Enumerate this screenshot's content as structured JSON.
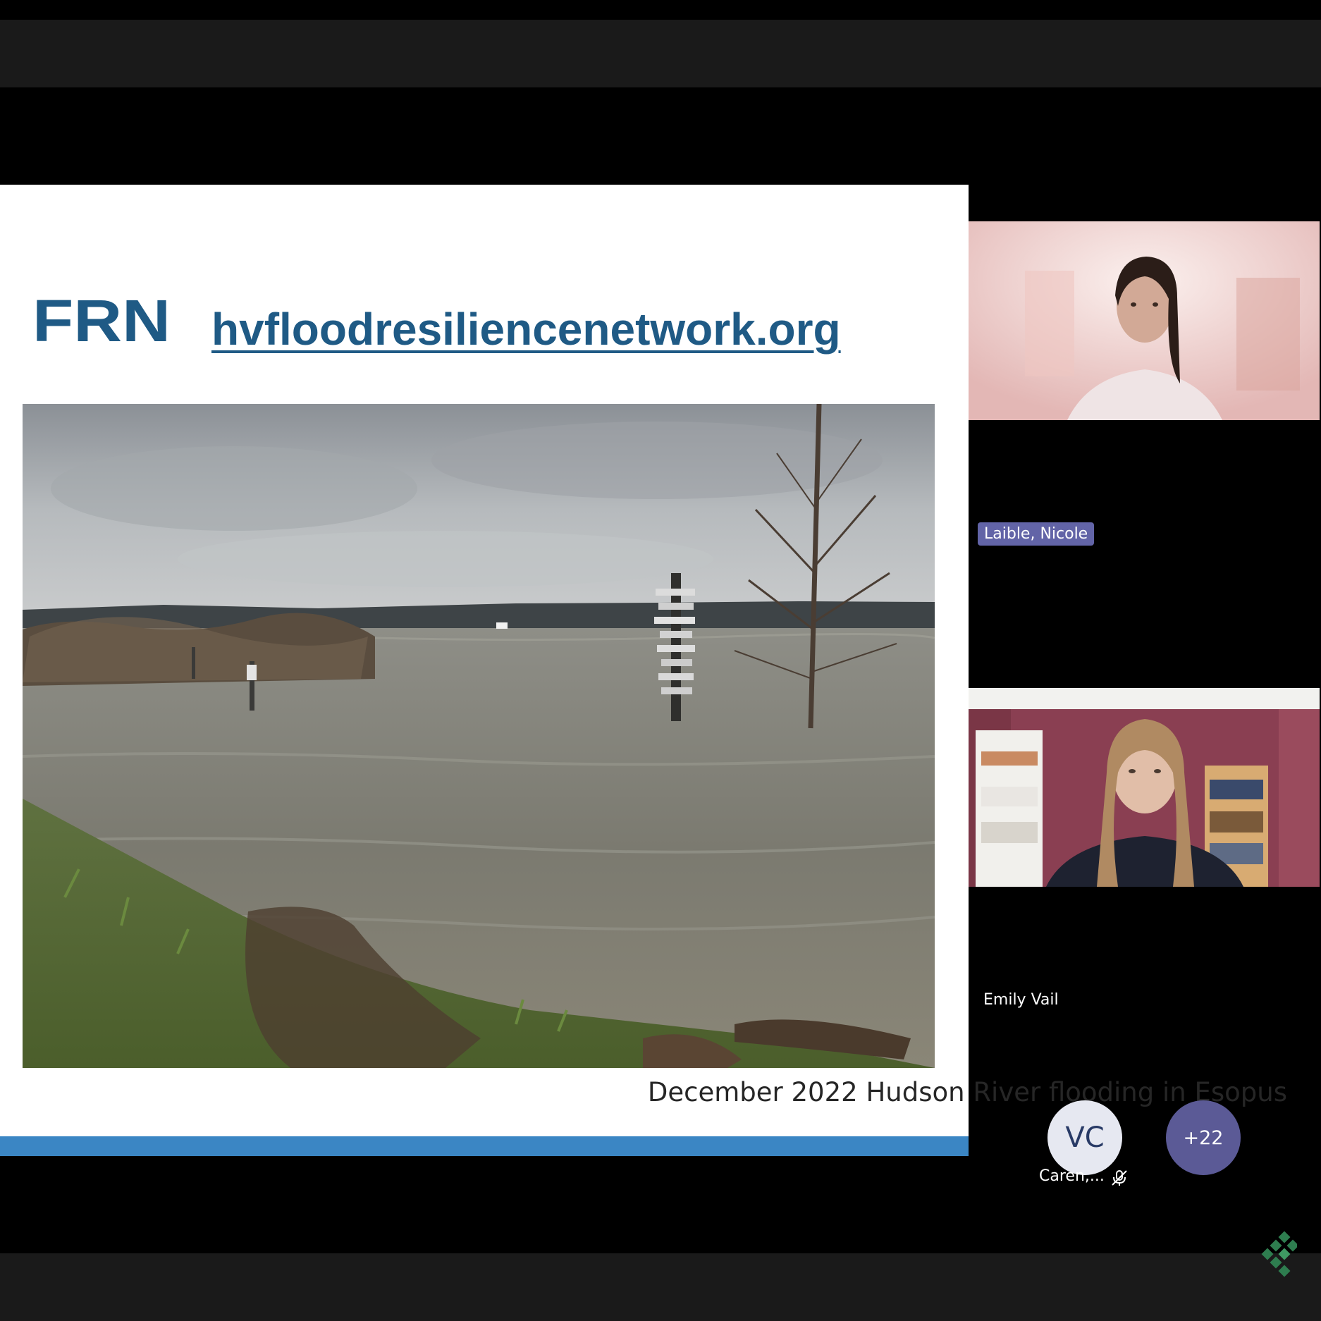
{
  "slide": {
    "logo_text": "FRN",
    "url_text": "hvfloodresiliencenetwork.org",
    "caption": "December 2022 Hudson River flooding in Esopus",
    "accent_color": "#3b86c4",
    "logo_color": "#1f5a85"
  },
  "participants": [
    {
      "name": "Laible, Nicole",
      "has_video": true
    },
    {
      "name": "Emily Vail",
      "has_video": true
    }
  ],
  "avatars": [
    {
      "initials": "VC",
      "label": "Caren,...",
      "muted": true
    },
    {
      "initials": "+22"
    }
  ]
}
